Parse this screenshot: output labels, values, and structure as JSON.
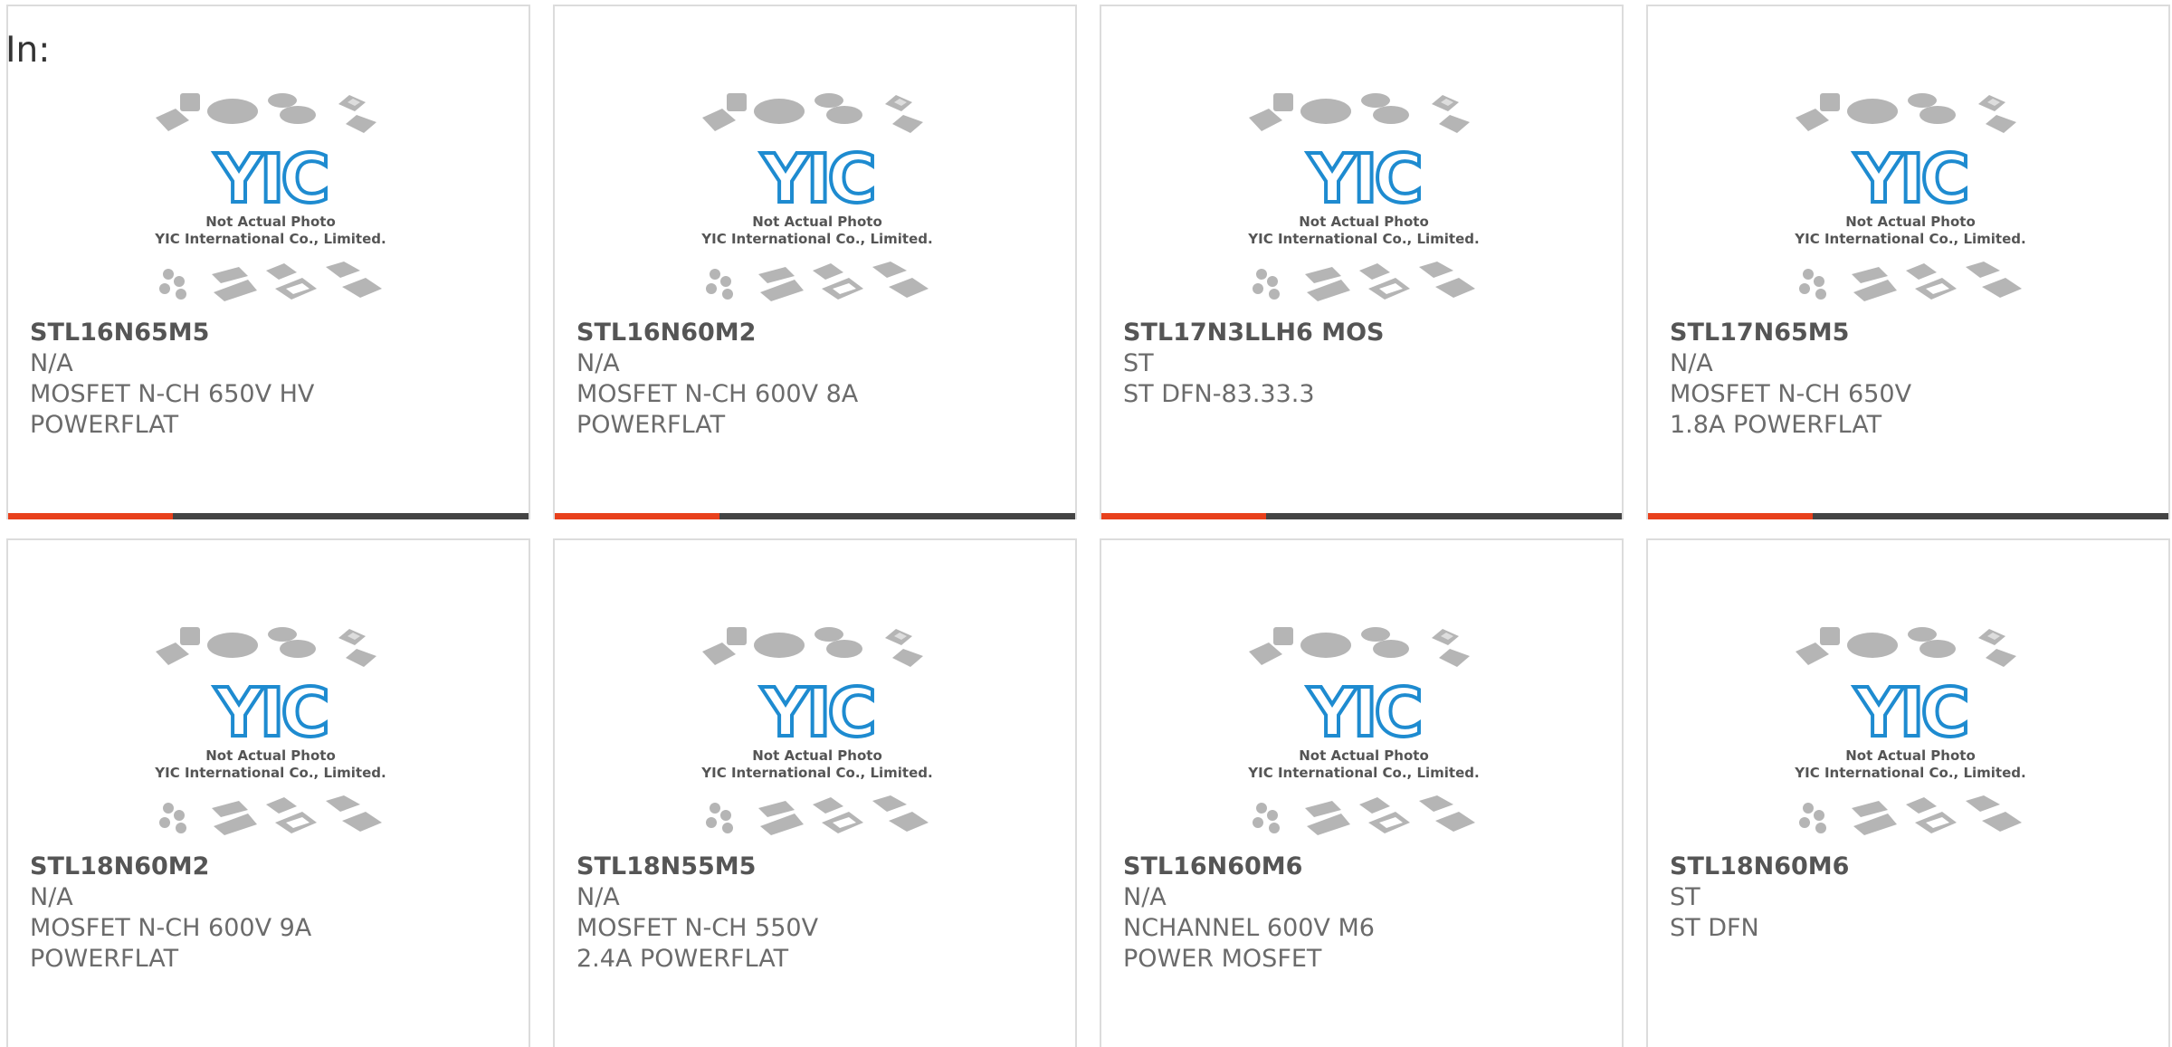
{
  "header": {
    "label": "In:"
  },
  "colors": {
    "accent": "#e8401c",
    "bar": "#444444",
    "logo": "#1e8bd0"
  },
  "placeholder": {
    "line1": "Not Actual Photo",
    "line2": "YIC International Co., Limited.",
    "logo_text": "YIC"
  },
  "products": [
    {
      "part": "STL16N65M5",
      "brand": "N/A",
      "desc": "MOSFET N-CH 650V HV POWERFLAT"
    },
    {
      "part": "STL16N60M2",
      "brand": "N/A",
      "desc": "MOSFET N-CH 600V 8A POWERFLAT"
    },
    {
      "part": "STL17N3LLH6 MOS",
      "brand": "ST",
      "desc": "ST DFN-83.33.3"
    },
    {
      "part": "STL17N65M5",
      "brand": "N/A",
      "desc": "MOSFET N-CH 650V 1.8A POWERFLAT"
    },
    {
      "part": "STL18N60M2",
      "brand": "N/A",
      "desc": "MOSFET N-CH 600V 9A POWERFLAT"
    },
    {
      "part": "STL18N55M5",
      "brand": "N/A",
      "desc": "MOSFET N-CH 550V 2.4A POWERFLAT"
    },
    {
      "part": "STL16N60M6",
      "brand": "N/A",
      "desc": "NCHANNEL 600V M6 POWER MOSFET"
    },
    {
      "part": "STL18N60M6",
      "brand": "ST",
      "desc": "ST DFN"
    }
  ]
}
